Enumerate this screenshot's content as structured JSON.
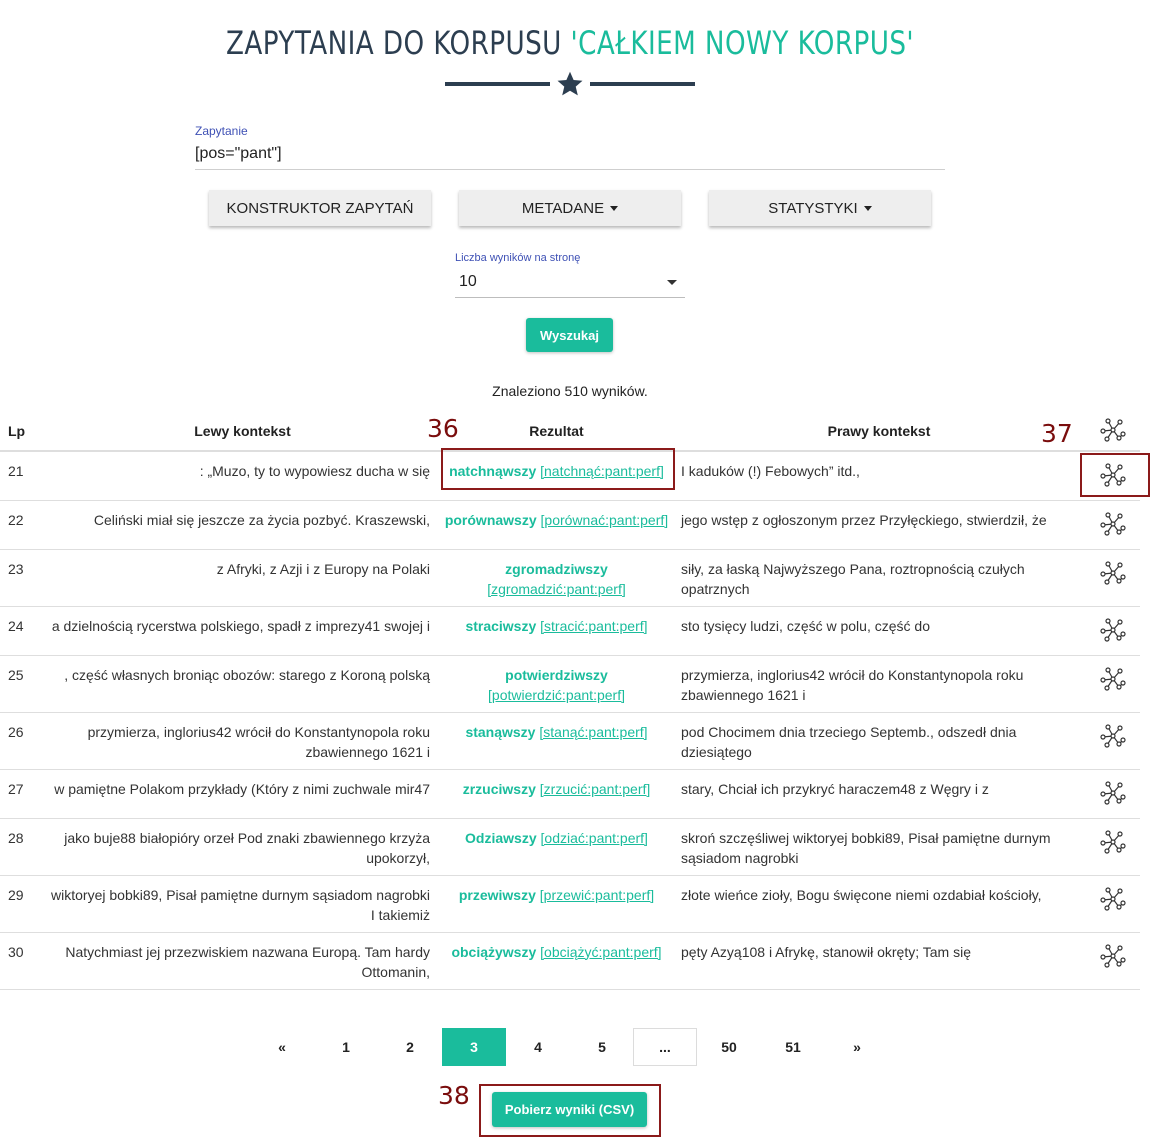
{
  "header": {
    "title_prefix": "ZAPYTANIA DO KORPUSU ",
    "title_highlight": "'CAŁKIEM NOWY KORPUS'",
    "star_icon": "star-icon"
  },
  "query": {
    "label": "Zapytanie",
    "value": "[pos=\"pant\"]"
  },
  "buttons": {
    "builder": "KONSTRUKTOR ZAPYTAŃ",
    "metadata": "METADANE",
    "statistics": "STATYSTYKI",
    "search": "Wyszukaj",
    "download": "Pobierz wyniki (CSV)"
  },
  "per_page": {
    "label": "Liczba wyników na stronę",
    "value": "10"
  },
  "results": {
    "found_text": "Znaleziono 510 wyników.",
    "columns": {
      "lp": "Lp",
      "left": "Lewy kontekst",
      "result": "Rezultat",
      "right": "Prawy kontekst"
    },
    "rows": [
      {
        "lp": "21",
        "left": ": „Muzo, ty to wypowiesz ducha w się",
        "word": "natchnąwszy",
        "lemma": "[natchnąć:pant:perf]",
        "right": "I kaduków (!) Febowych” itd.,"
      },
      {
        "lp": "22",
        "left": "Celiński miał się jeszcze za życia pozbyć. Kraszewski,",
        "word": "porównawszy",
        "lemma": "[porównać:pant:perf]",
        "right": "jego wstęp z ogłoszonym przez Przyłęckiego, stwierdził, że"
      },
      {
        "lp": "23",
        "left": "z Afryki, z Azji i z Europy na Polaki",
        "word": "zgromadziwszy",
        "lemma": "[zgromadzić:pant:perf]",
        "right": "siły, za łaską Najwyższego Pana, roztropnością czułych opatrznych"
      },
      {
        "lp": "24",
        "left": "a dzielnością rycerstwa polskiego, spadł z imprezy41 swojej i",
        "word": "straciwszy",
        "lemma": "[stracić:pant:perf]",
        "right": "sto tysięcy ludzi, część w polu, część do"
      },
      {
        "lp": "25",
        "left": ", część własnych broniąc obozów: starego z Koroną polską",
        "word": "potwierdziwszy",
        "lemma": "[potwierdzić:pant:perf]",
        "right": "przymierza, inglorius42 wrócił do Konstantynopola roku zbawiennego 1621 i"
      },
      {
        "lp": "26",
        "left": "przymierza, inglorius42 wrócił do Konstantynopola roku zbawiennego 1621 i",
        "word": "stanąwszy",
        "lemma": "[stanąć:pant:perf]",
        "right": "pod Chocimem dnia trzeciego Septemb., odszedł dnia dziesiątego"
      },
      {
        "lp": "27",
        "left": "w pamiętne Polakom przykłady (Który z nimi zuchwale mir47",
        "word": "zrzuciwszy",
        "lemma": "[zrzucić:pant:perf]",
        "right": "stary, Chciał ich przykryć haraczem48 z Węgry i z"
      },
      {
        "lp": "28",
        "left": "jako buje88 białopióry orzeł Pod znaki zbawiennego krzyża upokorzył,",
        "word": "Odziawszy",
        "lemma": "[odziać:pant:perf]",
        "right": "skroń szczęśliwej wiktoryej bobki89, Pisał pamiętne durnym sąsiadom nagrobki"
      },
      {
        "lp": "29",
        "left": "wiktoryej bobki89, Pisał pamiętne durnym sąsiadom nagrobki I takiemiż",
        "word": "przewiwszy",
        "lemma": "[przewić:pant:perf]",
        "right": "złote wieńce zioły, Bogu święcone niemi ozdabiał kościoły,"
      },
      {
        "lp": "30",
        "left": "Natychmiast jej przezwiskiem nazwana Europą. Tam hardy Ottomanin,",
        "word": "obciążywszy",
        "lemma": "[obciążyć:pant:perf]",
        "right": "pęty Azyą108 i Afrykę, stanowił okręty; Tam się"
      }
    ]
  },
  "pagination": {
    "items": [
      "«",
      "1",
      "2",
      "3",
      "4",
      "5",
      "...",
      "50",
      "51",
      "»"
    ],
    "active": "3"
  },
  "annotations": {
    "a36": "36",
    "a37": "37",
    "a38": "38"
  },
  "colors": {
    "accent": "#1abc9c",
    "title": "#2c3e50",
    "annotation": "#8b1a1a"
  }
}
